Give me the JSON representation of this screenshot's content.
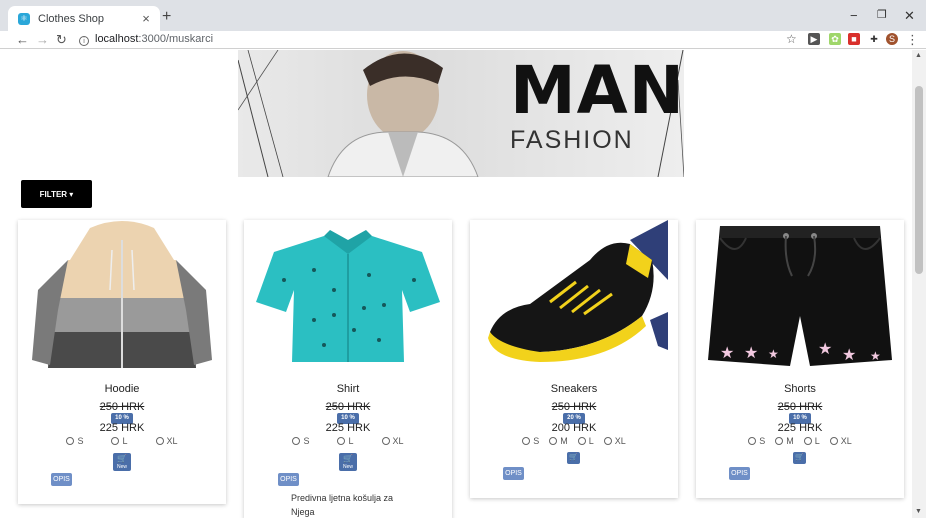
{
  "browser": {
    "tab_title": "Clothes Shop",
    "tab_close": "×",
    "new_tab": "+",
    "url_host": "localhost",
    "url_path": ":3000/muskarci",
    "window_controls": [
      "−",
      "❐",
      "✕"
    ],
    "profile_initial": "S"
  },
  "page": {
    "brand_main": "MAN",
    "brand_sub": "FASHION",
    "filter_label": "FILTER ▾",
    "products": [
      {
        "name": "Hoodie",
        "old_price": "250 HRK",
        "discount": "10 %",
        "new_price": "225 HRK",
        "sizes": [
          "S",
          "L",
          "XL"
        ],
        "cart_label": "New",
        "opis_label": "OPIS",
        "description": ""
      },
      {
        "name": "Shirt",
        "old_price": "250 HRK",
        "discount": "10 %",
        "new_price": "225 HRK",
        "sizes": [
          "S",
          "L",
          "XL"
        ],
        "cart_label": "New",
        "opis_label": "OPIS",
        "description": "Predivna ljetna košulja za Njega"
      },
      {
        "name": "Sneakers",
        "old_price": "250 HRK",
        "discount": "20 %",
        "new_price": "200 HRK",
        "sizes": [
          "S",
          "M",
          "L",
          "XL"
        ],
        "cart_label": "",
        "opis_label": "OPIS",
        "description": ""
      },
      {
        "name": "Shorts",
        "old_price": "250 HRK",
        "discount": "10 %",
        "new_price": "225 HRK",
        "sizes": [
          "S",
          "M",
          "L",
          "XL"
        ],
        "cart_label": "",
        "opis_label": "OPIS",
        "description": ""
      }
    ]
  },
  "colors": {
    "accent_blue": "#4a6ea9",
    "opis_blue": "#6f8fc7",
    "filter_black": "#000000",
    "hoodie_cream": "#ecd3b0",
    "shirt_teal": "#2bbfc2",
    "sneaker_yellow": "#f2d21b"
  }
}
